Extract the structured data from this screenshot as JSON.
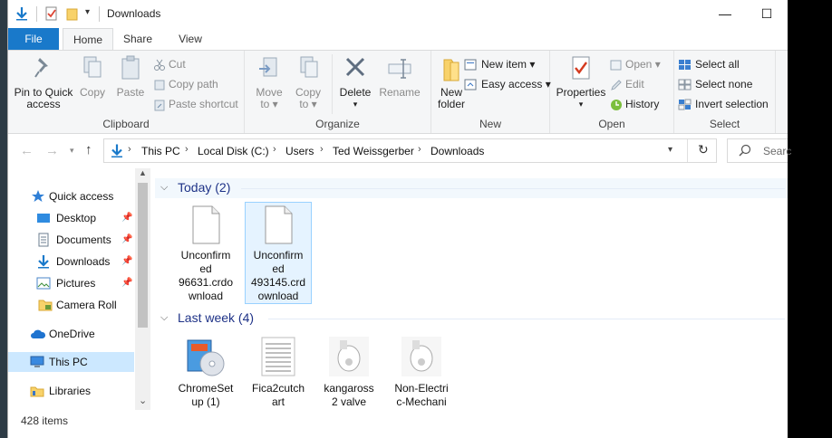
{
  "window": {
    "title": "Downloads"
  },
  "window_controls": {
    "minimize": "—",
    "maximize": "☐"
  },
  "tabs": [
    {
      "label": "File"
    },
    {
      "label": "Home"
    },
    {
      "label": "Share"
    },
    {
      "label": "View"
    }
  ],
  "ribbon": {
    "clipboard": {
      "label": "Clipboard",
      "pin_line1": "Pin to Quick",
      "pin_line2": "access",
      "copy": "Copy",
      "paste": "Paste",
      "cut": "Cut",
      "copy_path": "Copy path",
      "paste_shortcut": "Paste shortcut"
    },
    "organize": {
      "label": "Organize",
      "move_to": "Move",
      "move_to_2": "to",
      "copy_to": "Copy",
      "copy_to_2": "to",
      "delete": "Delete",
      "rename": "Rename"
    },
    "new": {
      "label": "New",
      "new_folder_1": "New",
      "new_folder_2": "folder",
      "new_item": "New item",
      "easy_access": "Easy access"
    },
    "open": {
      "label": "Open",
      "properties": "Properties",
      "open": "Open",
      "edit": "Edit",
      "history": "History"
    },
    "select": {
      "label": "Select",
      "select_all": "Select all",
      "select_none": "Select none",
      "invert": "Invert selection"
    }
  },
  "address": {
    "crumbs": [
      "This PC",
      "Local Disk (C:)",
      "Users",
      "Ted Weissgerber",
      "Downloads"
    ],
    "search_placeholder": "Searc"
  },
  "nav": {
    "items": [
      {
        "label": "Quick access"
      },
      {
        "label": "Desktop"
      },
      {
        "label": "Documents"
      },
      {
        "label": "Downloads"
      },
      {
        "label": "Pictures"
      },
      {
        "label": "Camera Roll"
      },
      {
        "label": "OneDrive"
      },
      {
        "label": "This PC"
      },
      {
        "label": "Libraries"
      }
    ]
  },
  "content": {
    "groups": [
      {
        "label": "Today (2)",
        "files": [
          {
            "name_l1": "Unconfirm",
            "name_l2": "ed",
            "name_l3": "96631.crdo",
            "name_l4": "wnload"
          },
          {
            "name_l1": "Unconfirm",
            "name_l2": "ed",
            "name_l3": "493145.crd",
            "name_l4": "ownload"
          }
        ]
      },
      {
        "label": "Last week (4)",
        "files": [
          {
            "name_l1": "ChromeSet",
            "name_l2": "up (1)"
          },
          {
            "name_l1": "Fica2cutch",
            "name_l2": "art"
          },
          {
            "name_l1": "kangaross",
            "name_l2": "2 valve"
          },
          {
            "name_l1": "Non-Electri",
            "name_l2": "c-Mechani"
          }
        ]
      }
    ]
  },
  "status": {
    "count": "428 items"
  },
  "colors": {
    "accent": "#1979ca",
    "selection": "#cce8ff",
    "group_heading": "#1e3287"
  }
}
